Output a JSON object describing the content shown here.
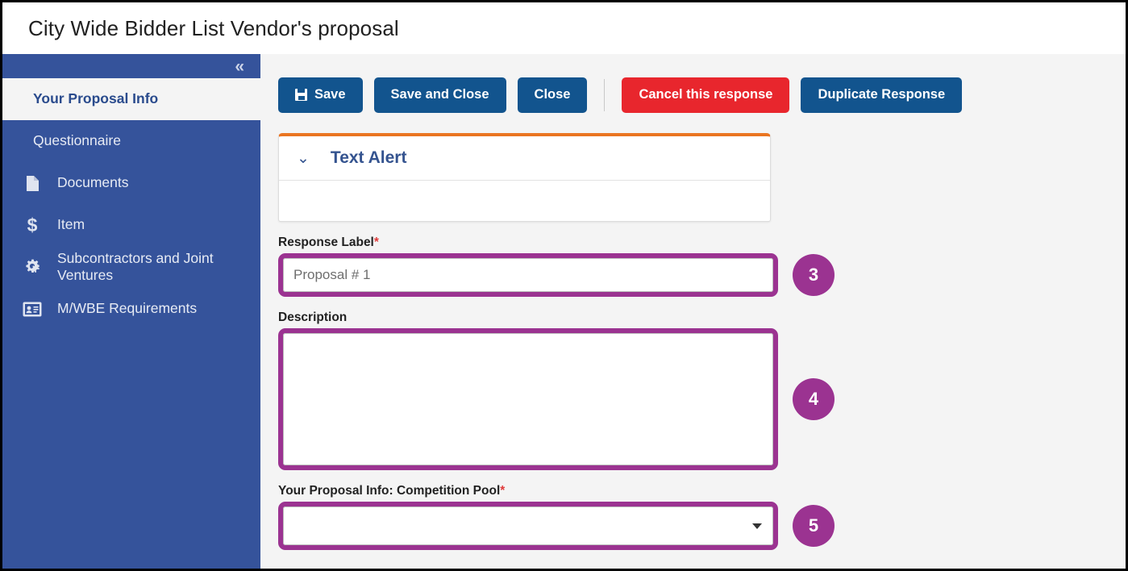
{
  "window": {
    "title": "City Wide Bidder List Vendor's proposal"
  },
  "sidebar": {
    "collapse_icon": "«",
    "items": [
      {
        "label": "Your Proposal Info",
        "icon": "",
        "active": true
      },
      {
        "label": "Questionnaire",
        "icon": "",
        "active": false
      },
      {
        "label": "Documents",
        "icon": "document-icon",
        "active": false
      },
      {
        "label": "Item",
        "icon": "dollar-icon",
        "active": false
      },
      {
        "label": "Subcontractors and Joint Ventures",
        "icon": "cogs-icon",
        "active": false
      },
      {
        "label": "M/WBE Requirements",
        "icon": "id-card-icon",
        "active": false
      }
    ]
  },
  "toolbar": {
    "save_label": "Save",
    "save_and_close_label": "Save and Close",
    "close_label": "Close",
    "cancel_label": "Cancel this response",
    "duplicate_label": "Duplicate Response"
  },
  "alert_panel": {
    "chevron": "⌄",
    "title": "Text Alert",
    "body": ""
  },
  "form": {
    "response_label": {
      "label": "Response Label",
      "required_marker": "*",
      "value": "Proposal # 1",
      "placeholder": "Proposal # 1",
      "badge": "3"
    },
    "description": {
      "label": "Description",
      "required_marker": "",
      "value": "",
      "placeholder": "",
      "badge": "4"
    },
    "competition_pool": {
      "label": "Your Proposal Info: Competition Pool",
      "required_marker": "*",
      "value": "",
      "options": [
        ""
      ],
      "badge": "5"
    }
  },
  "colors": {
    "sidebar_blue": "#35539B",
    "button_blue": "#12548E",
    "danger_red": "#E8262D",
    "panel_orange": "#EA7521",
    "annotation_purple": "#9B3391",
    "required_red": "#E03B3B"
  }
}
